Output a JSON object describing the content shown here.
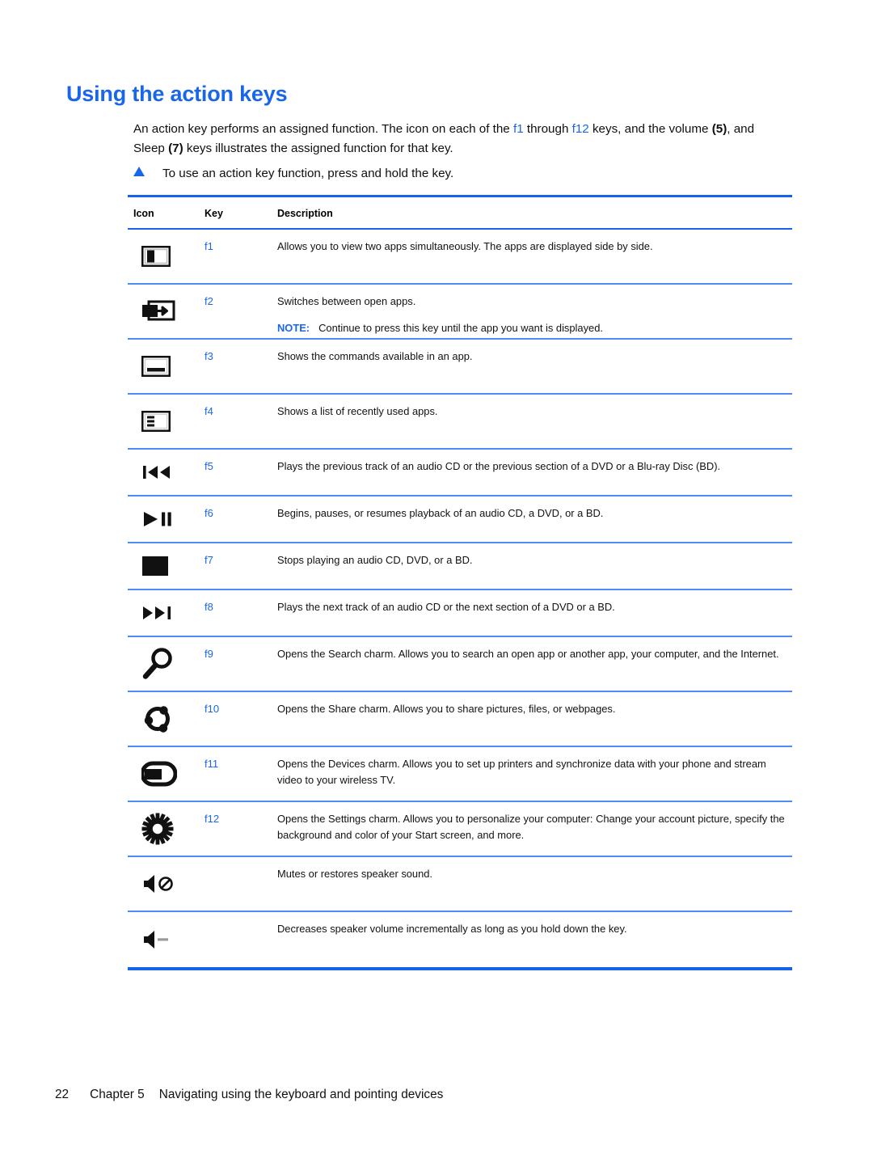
{
  "heading": "Using the action keys",
  "intro": {
    "part1": "An action key performs an assigned function. The icon on each of the ",
    "link1": "f1",
    "part2": " through ",
    "link2": "f12",
    "part3": " keys, and the volume ",
    "bold1": "(5)",
    "part4": ", and Sleep ",
    "bold2": "(7)",
    "part5": " keys illustrates the assigned function for that key."
  },
  "bullet": {
    "marker": "triangle-bullet",
    "text": "To use an action key function, press and hold the key."
  },
  "table": {
    "columns": [
      "Icon",
      "Key",
      "Description"
    ],
    "rows": [
      {
        "icon": "split-screen-icon",
        "key": "f1",
        "description": "Allows you to view two apps simultaneously. The apps are displayed side by side.",
        "note_label": "",
        "note_text": ""
      },
      {
        "icon": "switch-apps-icon",
        "key": "f2",
        "description": "Switches between open apps.",
        "note_label": "NOTE:",
        "note_text": "Continue to press this key until the app you want is displayed."
      },
      {
        "icon": "app-commands-icon",
        "key": "f3",
        "description": "Shows the commands available in an app.",
        "note_label": "",
        "note_text": ""
      },
      {
        "icon": "recent-apps-icon",
        "key": "f4",
        "description": "Shows a list of recently used apps.",
        "note_label": "",
        "note_text": ""
      },
      {
        "icon": "previous-track-icon",
        "key": "f5",
        "description": "Plays the previous track of an audio CD or the previous section of a DVD or a Blu-ray Disc (BD).",
        "note_label": "",
        "note_text": ""
      },
      {
        "icon": "play-pause-icon",
        "key": "f6",
        "description": "Begins, pauses, or resumes playback of an audio CD, a DVD, or a BD.",
        "note_label": "",
        "note_text": ""
      },
      {
        "icon": "stop-icon",
        "key": "f7",
        "description": "Stops playing an audio CD, DVD, or a BD.",
        "note_label": "",
        "note_text": ""
      },
      {
        "icon": "next-track-icon",
        "key": "f8",
        "description": "Plays the next track of an audio CD or the next section of a DVD or a BD.",
        "note_label": "",
        "note_text": ""
      },
      {
        "icon": "search-icon",
        "key": "f9",
        "description": "Opens the Search charm. Allows you to search an open app or another app, your computer, and the Internet.",
        "note_label": "",
        "note_text": ""
      },
      {
        "icon": "share-icon",
        "key": "f10",
        "description": "Opens the Share charm. Allows you to share pictures, files, or webpages.",
        "note_label": "",
        "note_text": ""
      },
      {
        "icon": "devices-icon",
        "key": "f11",
        "description": "Opens the Devices charm. Allows you to set up printers and synchronize data with your phone and stream video to your wireless TV.",
        "note_label": "",
        "note_text": ""
      },
      {
        "icon": "settings-gear-icon",
        "key": "f12",
        "description": "Opens the Settings charm. Allows you to personalize your computer: Change your account picture, specify the background and color of your Start screen, and more.",
        "note_label": "",
        "note_text": ""
      },
      {
        "icon": "mute-icon",
        "key": "",
        "description": "Mutes or restores speaker sound.",
        "note_label": "",
        "note_text": ""
      },
      {
        "icon": "volume-down-icon",
        "key": "",
        "description": "Decreases speaker volume incrementally as long as you hold down the key.",
        "note_label": "",
        "note_text": ""
      }
    ]
  },
  "footer": {
    "page_number": "22",
    "chapter": "Chapter 5",
    "title": "Navigating using the keyboard and pointing devices"
  },
  "colors": {
    "accent_blue": "#1a66e8",
    "rule_blue": "#4c8cf5",
    "text": "#111111"
  }
}
